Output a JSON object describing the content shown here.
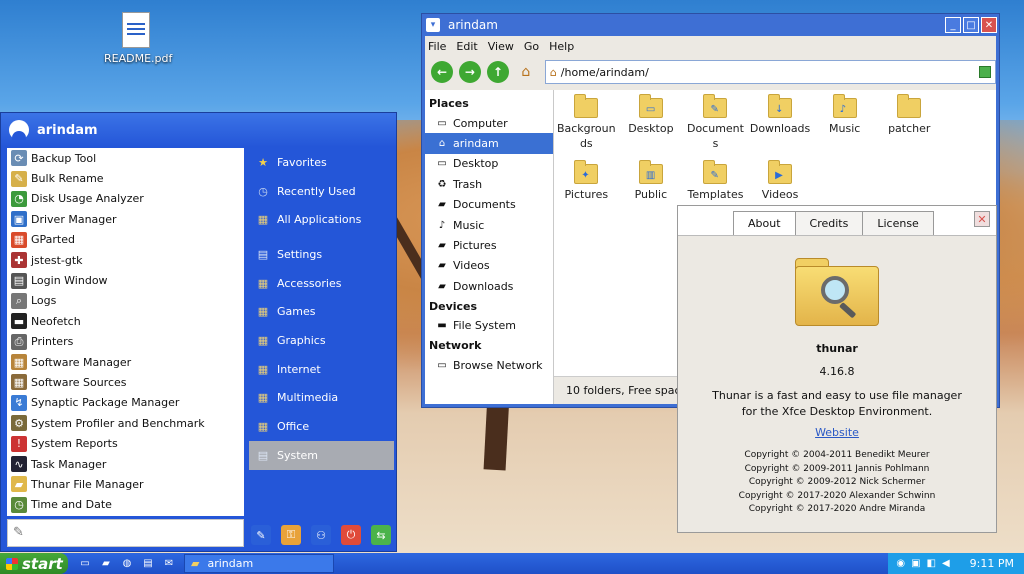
{
  "desktop": {
    "icon_label": "README.pdf"
  },
  "start_menu": {
    "user": "arindam",
    "apps": [
      {
        "label": "Backup Tool",
        "icon": "backup-icon",
        "glyph": "⟳",
        "color": "#6a8db4"
      },
      {
        "label": "Bulk Rename",
        "icon": "rename-icon",
        "glyph": "✎",
        "color": "#d6b04a"
      },
      {
        "label": "Disk Usage Analyzer",
        "icon": "disk-usage-icon",
        "glyph": "◔",
        "color": "#3c9a3c"
      },
      {
        "label": "Driver Manager",
        "icon": "driver-icon",
        "glyph": "▣",
        "color": "#2f6fc9"
      },
      {
        "label": "GParted",
        "icon": "gparted-icon",
        "glyph": "▦",
        "color": "#d94b2b"
      },
      {
        "label": "jstest-gtk",
        "icon": "joystick-icon",
        "glyph": "✚",
        "color": "#a33"
      },
      {
        "label": "Login Window",
        "icon": "login-icon",
        "glyph": "▤",
        "color": "#555"
      },
      {
        "label": "Logs",
        "icon": "logs-icon",
        "glyph": "⌕",
        "color": "#777"
      },
      {
        "label": "Neofetch",
        "icon": "terminal-icon",
        "glyph": "▬",
        "color": "#222"
      },
      {
        "label": "Printers",
        "icon": "printer-icon",
        "glyph": "⎙",
        "color": "#666"
      },
      {
        "label": "Software Manager",
        "icon": "software-manager-icon",
        "glyph": "▦",
        "color": "#b7843a"
      },
      {
        "label": "Software Sources",
        "icon": "software-sources-icon",
        "glyph": "▦",
        "color": "#8a6a3a"
      },
      {
        "label": "Synaptic Package Manager",
        "icon": "synaptic-icon",
        "glyph": "↯",
        "color": "#3a7bd5"
      },
      {
        "label": "System Profiler and Benchmark",
        "icon": "profiler-icon",
        "glyph": "⚙",
        "color": "#7a6a3a"
      },
      {
        "label": "System Reports",
        "icon": "reports-icon",
        "glyph": "!",
        "color": "#c33"
      },
      {
        "label": "Task Manager",
        "icon": "task-manager-icon",
        "glyph": "∿",
        "color": "#223"
      },
      {
        "label": "Thunar File Manager",
        "icon": "thunar-icon",
        "glyph": "▰",
        "color": "#e0b84a"
      },
      {
        "label": "Time and Date",
        "icon": "clock-icon",
        "glyph": "◷",
        "color": "#5a8a3a"
      }
    ],
    "categories": [
      {
        "label": "Favorites",
        "icon": "star-icon",
        "glyph": "★",
        "color": "#f3d04a"
      },
      {
        "label": "Recently Used",
        "icon": "recent-icon",
        "glyph": "◷",
        "color": "#c9d8f0"
      },
      {
        "label": "All Applications",
        "icon": "all-apps-icon",
        "glyph": "▦",
        "color": "#e9cf7a"
      },
      {
        "label": "Settings",
        "icon": "settings-icon",
        "glyph": "▤",
        "color": "#dde6f5"
      },
      {
        "label": "Accessories",
        "icon": "accessories-icon",
        "glyph": "▦",
        "color": "#e9cf7a"
      },
      {
        "label": "Games",
        "icon": "games-icon",
        "glyph": "▦",
        "color": "#e9cf7a"
      },
      {
        "label": "Graphics",
        "icon": "graphics-icon",
        "glyph": "▦",
        "color": "#e9cf7a"
      },
      {
        "label": "Internet",
        "icon": "internet-icon",
        "glyph": "▦",
        "color": "#e9cf7a"
      },
      {
        "label": "Multimedia",
        "icon": "multimedia-icon",
        "glyph": "▦",
        "color": "#e9cf7a"
      },
      {
        "label": "Office",
        "icon": "office-icon",
        "glyph": "▦",
        "color": "#e9cf7a"
      },
      {
        "label": "System",
        "icon": "system-icon",
        "glyph": "▤",
        "color": "#dde6f5",
        "selected": true
      }
    ],
    "actions": [
      {
        "name": "settings-manager-icon",
        "glyph": "✎",
        "bg": "#2a5fd8"
      },
      {
        "name": "lock-screen-icon",
        "glyph": "⚿",
        "bg": "#e8a23a"
      },
      {
        "name": "switch-user-icon",
        "glyph": "⚇",
        "bg": "#2a5fd8"
      },
      {
        "name": "logout-icon",
        "glyph": "⏻",
        "bg": "#e04b3a"
      },
      {
        "name": "switch-session-icon",
        "glyph": "⇆",
        "bg": "#4bb34b"
      }
    ]
  },
  "file_manager": {
    "title": "arindam",
    "menu": [
      "File",
      "Edit",
      "View",
      "Go",
      "Help"
    ],
    "location": "/home/arindam/",
    "places_heading": "Places",
    "places": [
      {
        "label": "Computer",
        "icon": "computer-icon",
        "glyph": "▭"
      },
      {
        "label": "arindam",
        "icon": "home-icon",
        "glyph": "⌂",
        "selected": true
      },
      {
        "label": "Desktop",
        "icon": "desktop-icon",
        "glyph": "▭"
      },
      {
        "label": "Trash",
        "icon": "trash-icon",
        "glyph": "♻"
      },
      {
        "label": "Documents",
        "icon": "documents-icon",
        "glyph": "▰"
      },
      {
        "label": "Music",
        "icon": "music-icon",
        "glyph": "♪"
      },
      {
        "label": "Pictures",
        "icon": "pictures-icon",
        "glyph": "▰"
      },
      {
        "label": "Videos",
        "icon": "videos-icon",
        "glyph": "▰"
      },
      {
        "label": "Downloads",
        "icon": "downloads-icon",
        "glyph": "▰"
      }
    ],
    "devices_heading": "Devices",
    "devices": [
      {
        "label": "File System",
        "icon": "drive-icon",
        "glyph": "▬"
      }
    ],
    "network_heading": "Network",
    "network": [
      {
        "label": "Browse Network",
        "icon": "network-icon",
        "glyph": "▭"
      }
    ],
    "items": [
      {
        "label": "Backgroun ds",
        "icon": "folder-icon",
        "mini": ""
      },
      {
        "label": "Desktop",
        "icon": "desktop-folder-icon",
        "mini": "▭"
      },
      {
        "label": "Document s",
        "icon": "documents-folder-icon",
        "mini": "✎"
      },
      {
        "label": "Downloads",
        "icon": "downloads-folder-icon",
        "mini": "↓"
      },
      {
        "label": "Music",
        "icon": "music-folder-icon",
        "mini": "♪"
      },
      {
        "label": "patcher",
        "icon": "folder-icon",
        "mini": ""
      },
      {
        "label": "Pictures",
        "icon": "pictures-folder-icon",
        "mini": "✦"
      },
      {
        "label": "Public",
        "icon": "public-folder-icon",
        "mini": "▥"
      },
      {
        "label": "Templates",
        "icon": "templates-folder-icon",
        "mini": "✎"
      },
      {
        "label": "Videos",
        "icon": "videos-folder-icon",
        "mini": "▶"
      }
    ],
    "status": "10 folders, Free space:"
  },
  "about": {
    "tabs": [
      "About",
      "Credits",
      "License"
    ],
    "name": "thunar",
    "version": "4.16.8",
    "description": "Thunar is a fast and easy to use file manager for the Xfce Desktop Environment.",
    "website": "Website",
    "copyrights": [
      "Copyright © 2004-2011 Benedikt Meurer",
      "Copyright © 2009-2011 Jannis Pohlmann",
      "Copyright © 2009-2012 Nick Schermer",
      "Copyright © 2017-2020 Alexander Schwinn",
      "Copyright © 2017-2020 Andre Miranda"
    ]
  },
  "taskbar": {
    "start_label": "start",
    "task_label": "arindam",
    "clock": "9:11 PM"
  }
}
